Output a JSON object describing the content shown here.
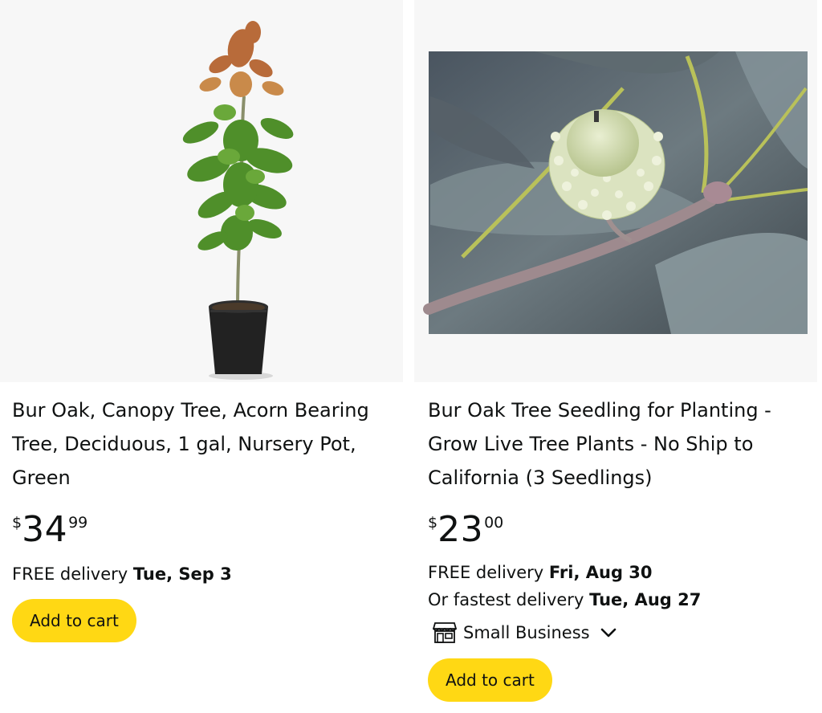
{
  "products": [
    {
      "title": "Bur Oak, Canopy Tree, Acorn Bearing Tree, Deciduous, 1 gal, Nursery Pot, Green",
      "price": {
        "symbol": "$",
        "whole": "34",
        "fraction": "99"
      },
      "delivery_line": {
        "prefix": "FREE delivery ",
        "date": "Tue, Sep 3"
      },
      "cart_label": "Add to cart"
    },
    {
      "title": "Bur Oak Tree Seedling for Planting - Grow Live Tree Plants - No Ship to California (3 Seedlings)",
      "price": {
        "symbol": "$",
        "whole": "23",
        "fraction": "00"
      },
      "delivery_line": {
        "prefix": "FREE delivery ",
        "date": "Fri, Aug 30"
      },
      "fastest_line": {
        "prefix": "Or fastest delivery ",
        "date": "Tue, Aug 27"
      },
      "badge": {
        "label": "Small Business",
        "icon": "store-icon"
      },
      "cart_label": "Add to cart"
    }
  ],
  "colors": {
    "cart_button": "#ffd814",
    "text": "#0f1111",
    "image_bg": "#f7f7f7"
  }
}
